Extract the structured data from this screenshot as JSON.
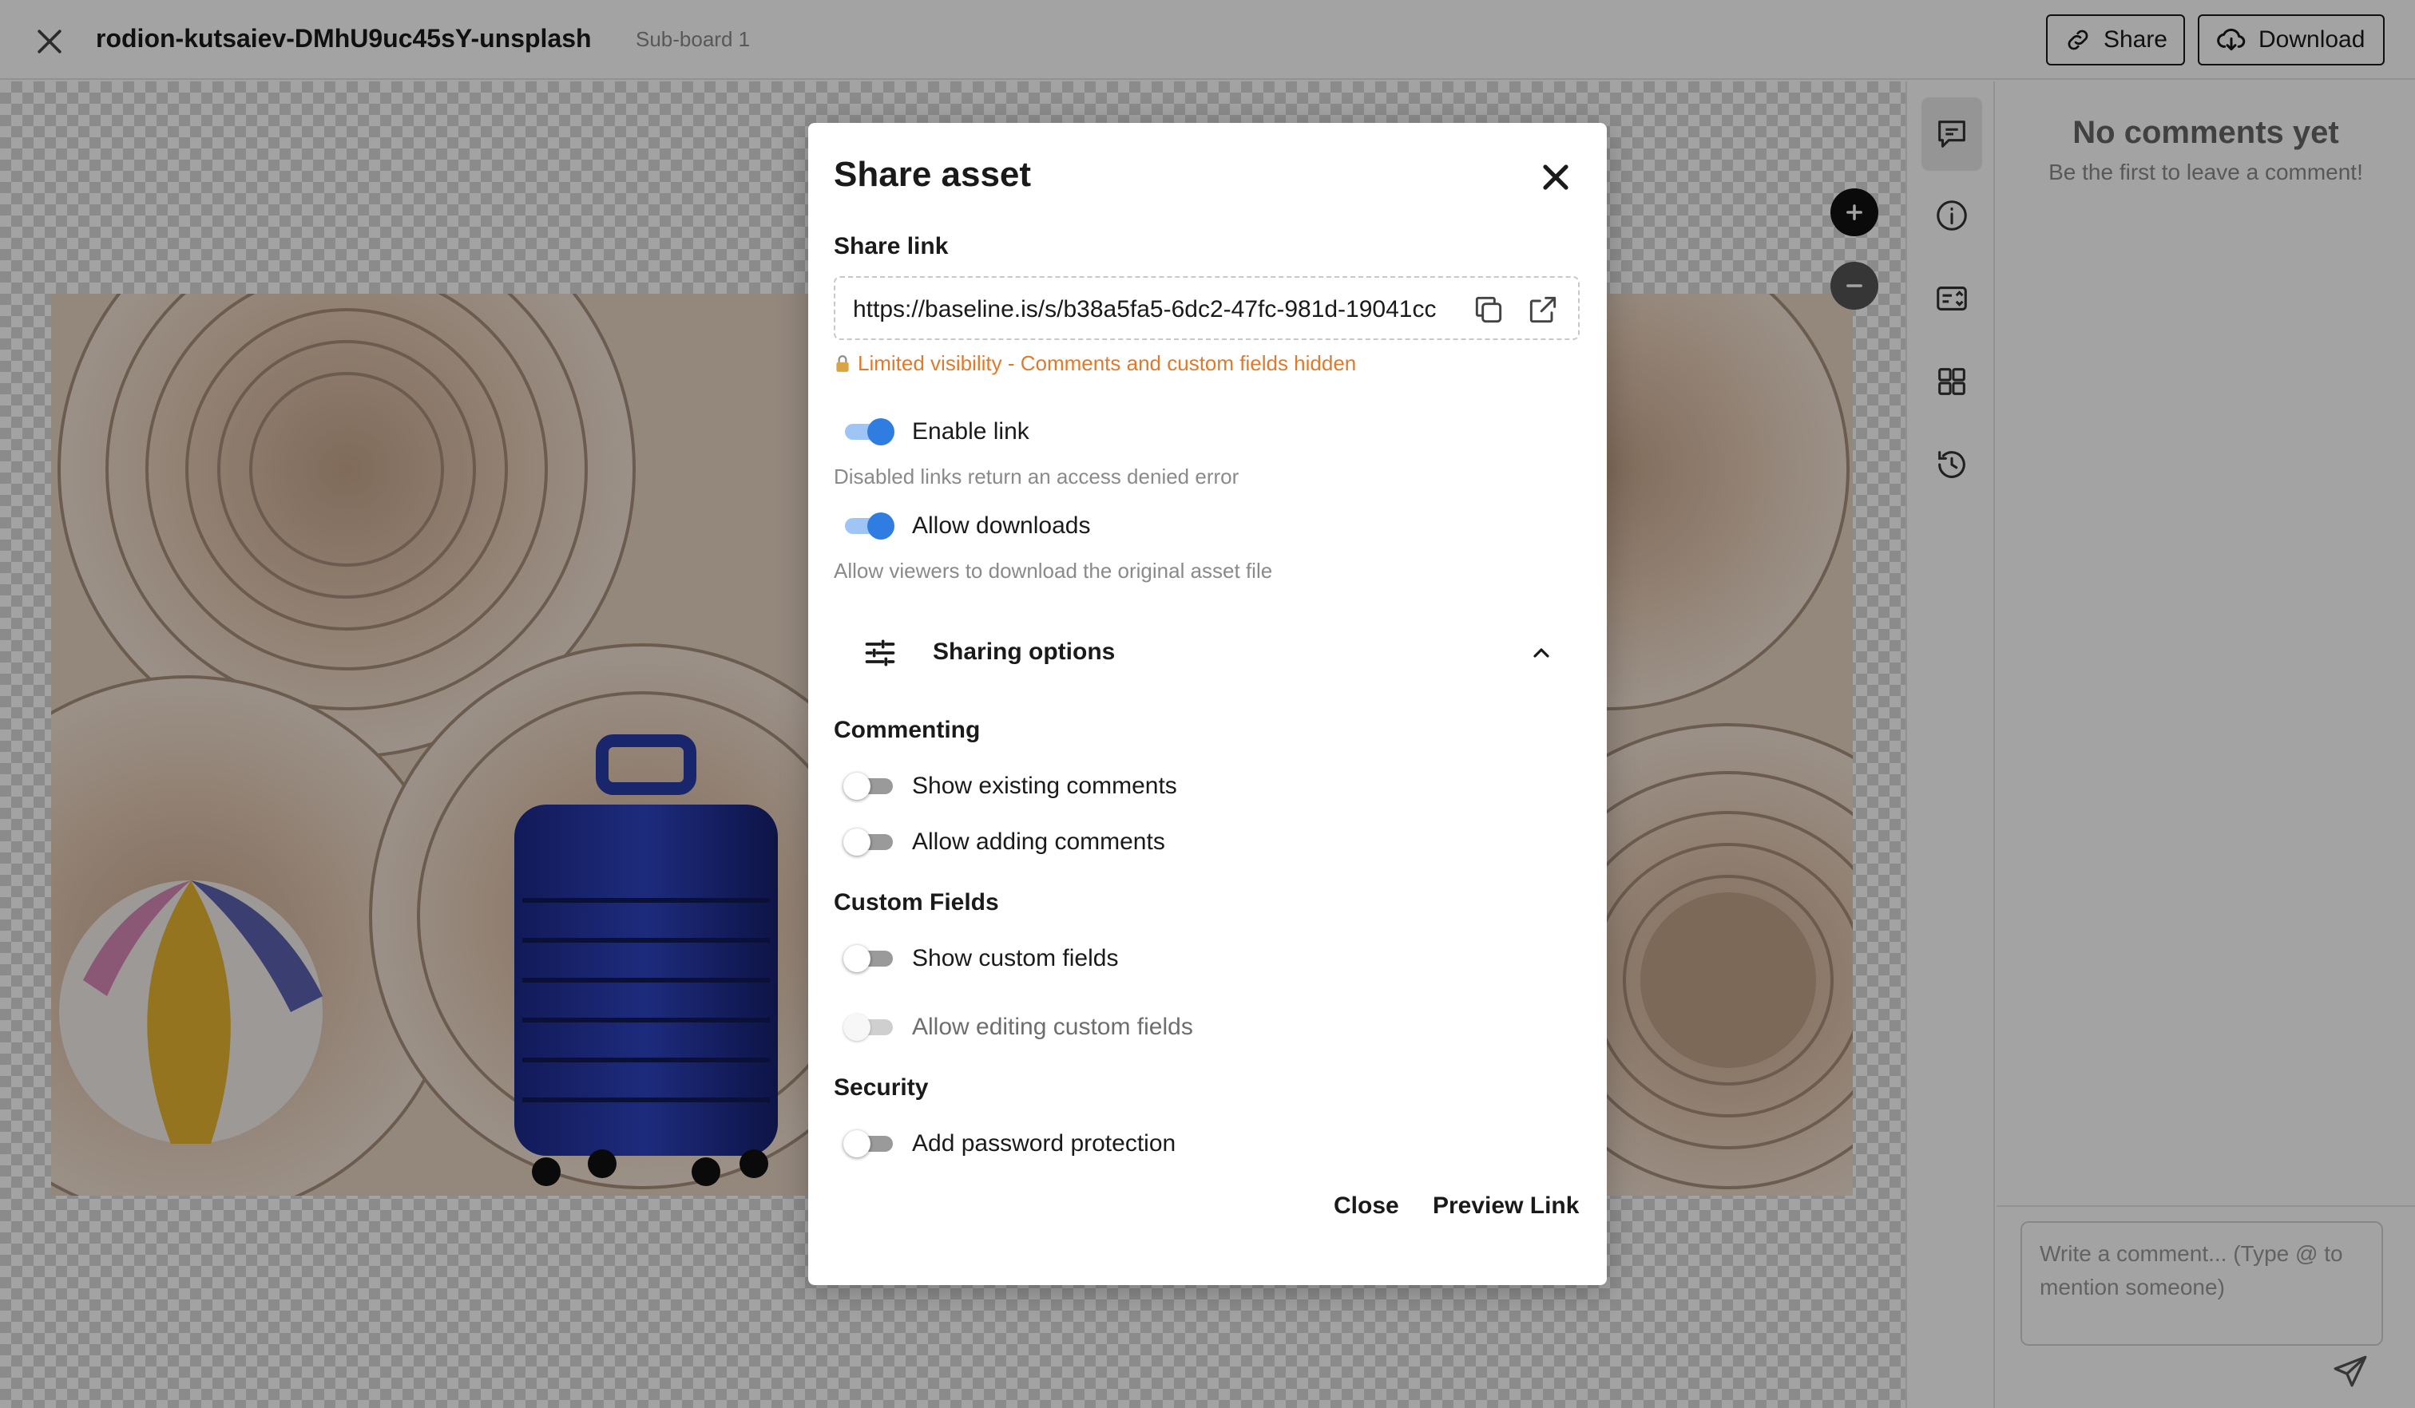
{
  "header": {
    "title": "rodion-kutsaiev-DMhU9uc45sY-unsplash",
    "subtitle": "Sub-board 1",
    "share_label": "Share",
    "download_label": "Download"
  },
  "comments_panel": {
    "empty_title": "No comments yet",
    "empty_subtitle": "Be the first to leave a comment!",
    "input_placeholder": "Write a comment... (Type @ to mention someone)"
  },
  "modal": {
    "title": "Share asset",
    "share_link_label": "Share link",
    "share_link_url": "https://baseline.is/s/b38a5fa5-6dc2-47fc-981d-19041cc",
    "visibility_note": "Limited visibility - Comments and custom fields hidden",
    "enable_link": {
      "label": "Enable link",
      "on": true,
      "helper": "Disabled links return an access denied error"
    },
    "allow_downloads": {
      "label": "Allow downloads",
      "on": true,
      "helper": "Allow viewers to download the original asset file"
    },
    "sharing_options_label": "Sharing options",
    "commenting": {
      "heading": "Commenting",
      "show_existing_label": "Show existing comments",
      "allow_adding_label": "Allow adding comments"
    },
    "custom_fields": {
      "heading": "Custom Fields",
      "show_label": "Show custom fields",
      "allow_editing_label": "Allow editing custom fields"
    },
    "security": {
      "heading": "Security",
      "password_label": "Add password protection"
    },
    "close_label": "Close",
    "preview_label": "Preview Link"
  },
  "colors": {
    "accent": "#2f7de1",
    "warning": "#e07a2a"
  },
  "icons": [
    "close-icon",
    "link-icon",
    "cloud-download-icon",
    "plus-icon",
    "minus-icon",
    "comment-icon",
    "info-icon",
    "custom-fields-icon",
    "grid-icon",
    "history-icon",
    "send-icon",
    "copy-icon",
    "external-link-icon",
    "lock-icon",
    "sliders-icon",
    "chevron-up-icon"
  ]
}
